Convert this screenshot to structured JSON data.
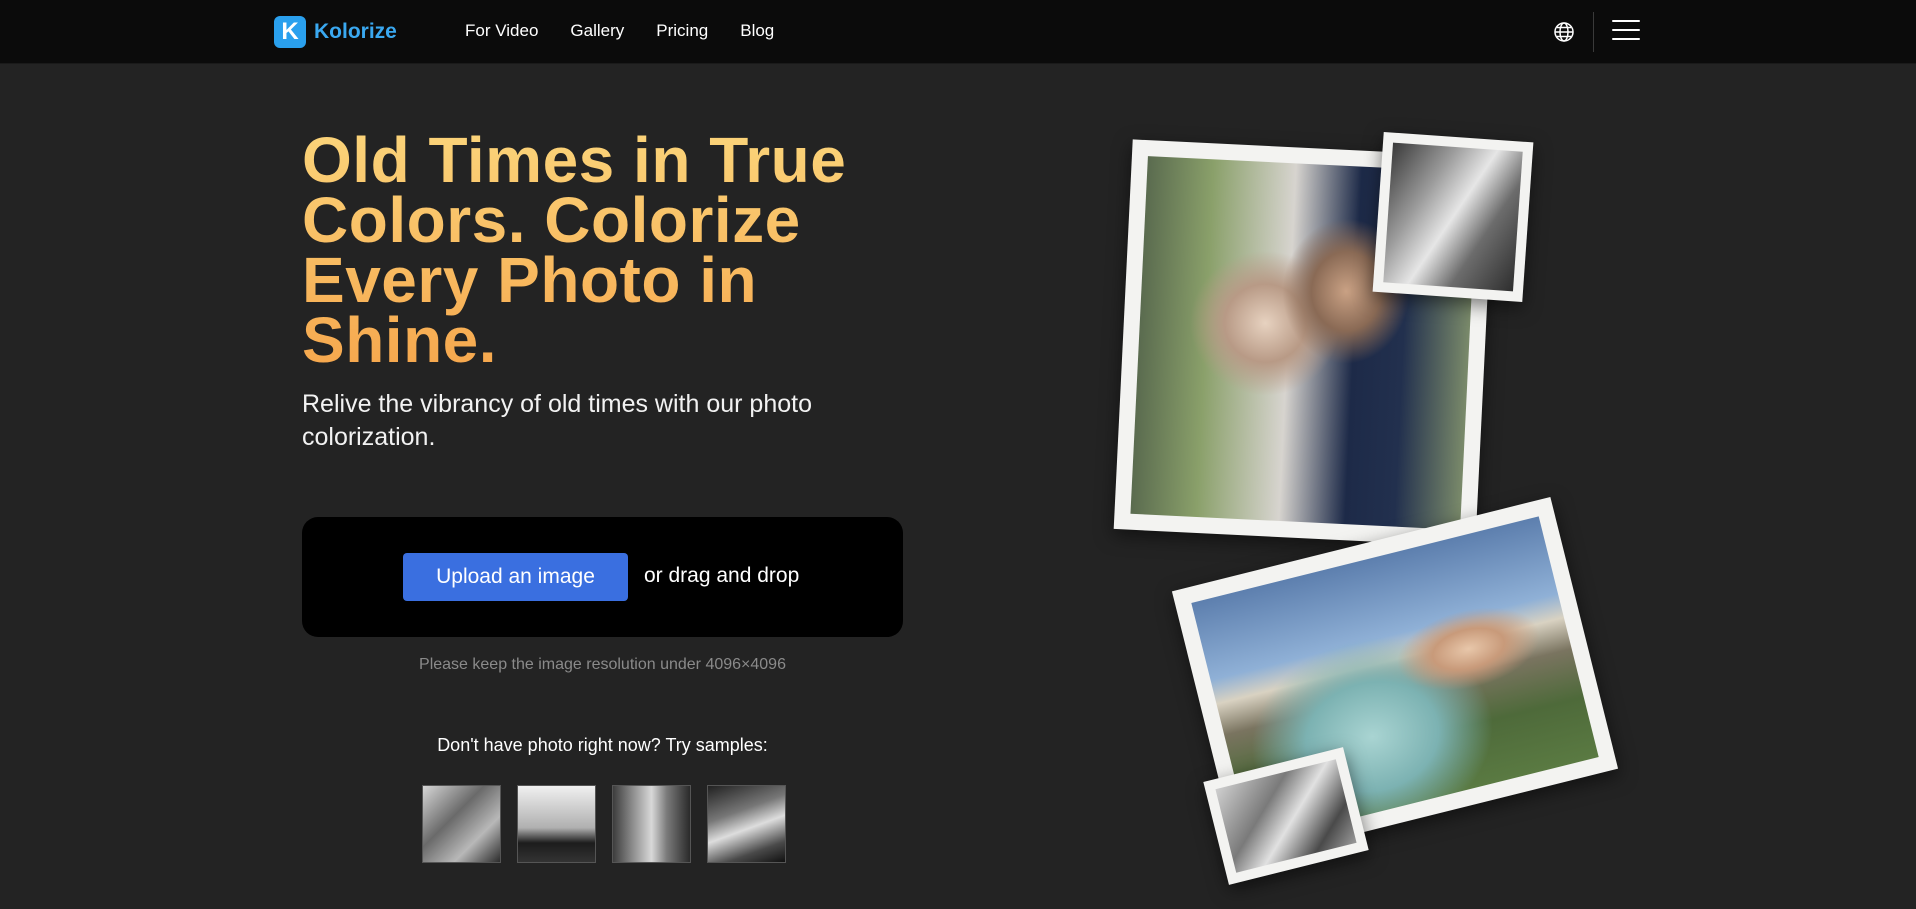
{
  "header": {
    "brand_letter": "K",
    "brand_name": "Kolorize",
    "nav": [
      "For Video",
      "Gallery",
      "Pricing",
      "Blog"
    ],
    "icons": [
      "globe-icon",
      "hamburger-menu-icon"
    ]
  },
  "hero": {
    "title": "Old Times in True Colors. Colorize Every Photo in Shine.",
    "subtitle": "Relive the vibrancy of old times with our photo colorization."
  },
  "upload": {
    "button_label": "Upload an image",
    "drag_text": "or drag and drop",
    "hint": "Please keep the image resolution under 4096×4096"
  },
  "samples": {
    "title": "Don't have photo right now? Try samples:",
    "count": 4
  },
  "colors": {
    "accent_blue": "#3a6fe0",
    "brand_blue": "#3aa8f0",
    "title_gradient_start": "#fbd47a",
    "title_gradient_end": "#f6a74d",
    "background": "#232323"
  }
}
